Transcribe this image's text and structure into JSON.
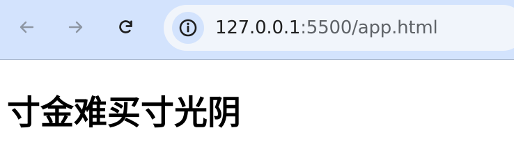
{
  "toolbar": {
    "back_icon": "arrow-left-icon",
    "forward_icon": "arrow-right-icon",
    "reload_icon": "reload-icon",
    "accent_color": "#d3e3fd"
  },
  "address_bar": {
    "info_icon": "info-icon",
    "url_host": "127.0.0.1",
    "url_rest": ":5500/app.html"
  },
  "page": {
    "heading": "寸金难买寸光阴"
  }
}
